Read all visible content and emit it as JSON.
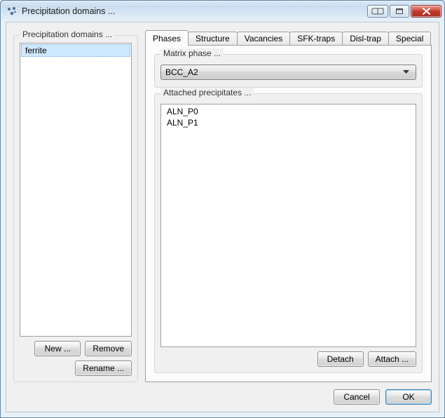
{
  "window": {
    "title": "Precipitation domains ..."
  },
  "left": {
    "legend": "Precipitation domains ...",
    "items": [
      "ferrite"
    ],
    "selected_index": 0,
    "buttons": {
      "new": "New ...",
      "remove": "Remove",
      "rename": "Rename ..."
    }
  },
  "tabs": {
    "items": [
      "Phases",
      "Structure",
      "Vacancies",
      "SFK-traps",
      "Disl-trap",
      "Special"
    ],
    "active_index": 0
  },
  "matrix": {
    "legend": "Matrix phase ...",
    "value": "BCC_A2"
  },
  "attached": {
    "legend": "Attached precipitates ...",
    "items": [
      "ALN_P0",
      "ALN_P1"
    ],
    "buttons": {
      "detach": "Detach",
      "attach": "Attach ..."
    }
  },
  "footer": {
    "cancel": "Cancel",
    "ok": "OK"
  }
}
